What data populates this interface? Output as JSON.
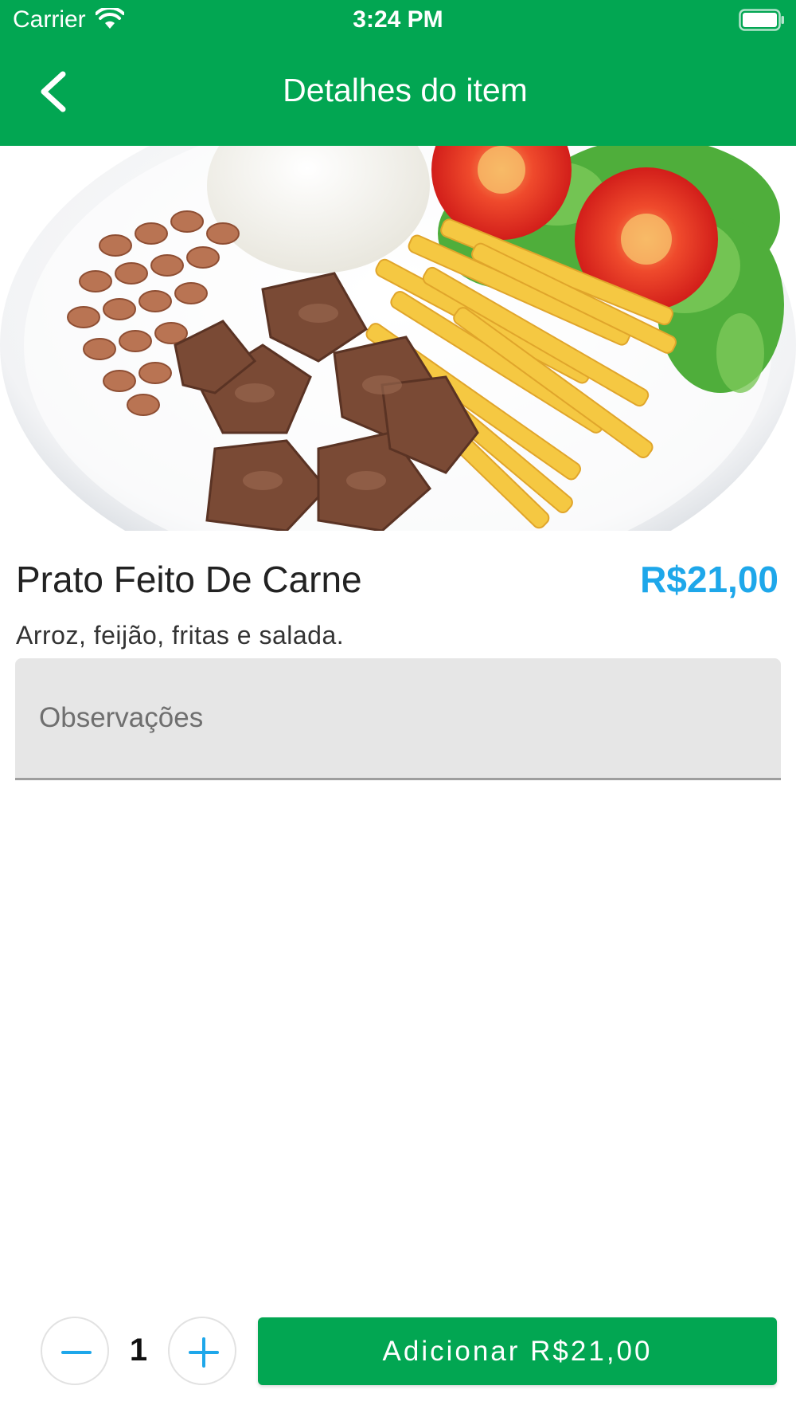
{
  "status_bar": {
    "carrier": "Carrier",
    "time": "3:24 PM",
    "wifi_icon": "wifi-icon",
    "battery_icon": "battery-icon"
  },
  "nav": {
    "title": "Detalhes do item",
    "back_icon": "chevron-left-icon"
  },
  "item": {
    "image_alt": "prato-feito-photo",
    "name": "Prato Feito De Carne",
    "price": "R$21,00",
    "description": "Arroz, feijão, fritas e salada."
  },
  "observations": {
    "placeholder": "Observações",
    "value": ""
  },
  "order": {
    "quantity": "1",
    "minus_icon": "minus-icon",
    "plus_icon": "plus-icon",
    "add_button_label": "Adicionar R$21,00"
  },
  "colors": {
    "primary_green": "#02a652",
    "price_blue": "#1ea7ea"
  }
}
